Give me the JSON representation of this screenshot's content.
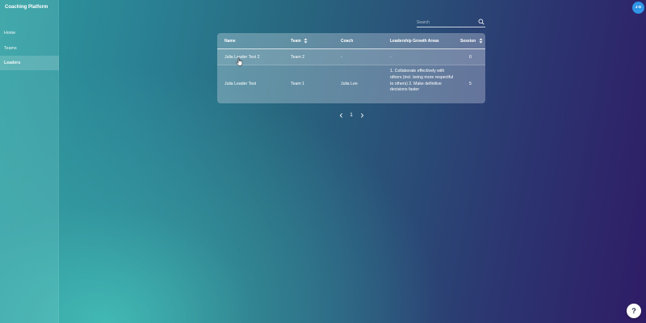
{
  "sidebar": {
    "brand": "Coaching Platform",
    "items": [
      {
        "label": "Home"
      },
      {
        "label": "Teams"
      },
      {
        "label": "Leaders"
      }
    ]
  },
  "header": {
    "avatar_initials": "J-D",
    "search": {
      "placeholder": "Search",
      "value": ""
    }
  },
  "table": {
    "columns": [
      {
        "label": "Name",
        "sortable": false
      },
      {
        "label": "Team",
        "sortable": true
      },
      {
        "label": "Coach",
        "sortable": false
      },
      {
        "label": "Leadership Growth Areas",
        "sortable": false
      },
      {
        "label": "Session",
        "sortable": true
      }
    ],
    "rows": [
      {
        "name": "Julia Leader Test 2",
        "team": "Team 2",
        "coach": "-",
        "growth_areas": "-",
        "session": "0"
      },
      {
        "name": "Julia Leader Test",
        "team": "Team 1",
        "coach": "Julia Lee",
        "growth_areas": "1. Collaborate effectively with others (incl. being more respectful to others) 2. Make definitive decisions faster",
        "session": "5"
      }
    ]
  },
  "pagination": {
    "current_page": "1",
    "prev": "‹",
    "next": "›"
  },
  "help": {
    "label": "?"
  },
  "colors": {
    "accent": "#2f95e6",
    "gradient_start": "#2e9a9e",
    "gradient_end": "#2f1c66"
  }
}
